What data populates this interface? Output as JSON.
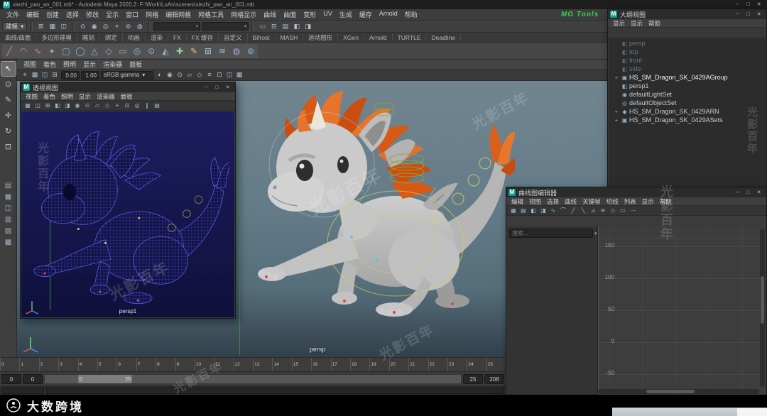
{
  "window": {
    "title": "xiezhi_pao_an_001.mb* - Autodesk Maya 2020.2: F:\\Work\\LuAn\\scenes\\xiezhi_pao_an_001.mb",
    "minimize": "─",
    "maximize": "□",
    "close": "✕"
  },
  "colors": {
    "accent_teal": "#0e9e93",
    "mane_orange": "#e0671c",
    "wire_blue": "#4646d8",
    "mg_green": "#38d053",
    "viewport_top": "#71858f",
    "wire_bg": "#14144a"
  },
  "menubar": {
    "items": [
      "文件",
      "编辑",
      "创建",
      "选择",
      "修改",
      "显示",
      "窗口",
      "网格",
      "编辑网格",
      "网格工具",
      "网格显示",
      "曲线",
      "曲面",
      "变形",
      "UV",
      "生成",
      "缓存",
      "Arnold",
      "帮助"
    ],
    "plugin": "MG Tools"
  },
  "statusline": {
    "workspace": "建模",
    "caret": "▾",
    "icons_a": [
      "⊞",
      "▦",
      "◫"
    ],
    "icons_b": [
      "⊙",
      "◉",
      "◎",
      "⌖",
      "⊚",
      "◍"
    ],
    "icons_c": [
      "▭",
      "⊟",
      "▤",
      "◧",
      "◨"
    ]
  },
  "shelf": {
    "tabs": [
      "曲线/曲面",
      "多边形建模",
      "雕刻",
      "绑定",
      "动画",
      "渲染",
      "FX",
      "FX 缓存",
      "自定义",
      "Bifrost",
      "MASH",
      "运动图形",
      "XGen",
      "Arnold",
      "TURTLE",
      "Deadline"
    ],
    "icons": [
      {
        "g": "╱",
        "c": "#d88a8a"
      },
      {
        "g": "◠",
        "c": "#d88a8a"
      },
      {
        "g": "∿",
        "c": "#d88a8a"
      },
      {
        "g": "+",
        "c": "#cfcfcf"
      },
      {
        "g": "▢",
        "c": "#8fb8d8"
      },
      {
        "g": "◯",
        "c": "#8fb8d8"
      },
      {
        "g": "△",
        "c": "#8fb8d8"
      },
      {
        "g": "◇",
        "c": "#8fb8d8"
      },
      {
        "g": "▭",
        "c": "#8fb8d8"
      },
      {
        "g": "◎",
        "c": "#8fb8d8"
      },
      {
        "g": "⊙",
        "c": "#8fb8d8"
      },
      {
        "g": "◭",
        "c": "#8fb8d8"
      },
      {
        "g": "✚",
        "c": "#9fd09f"
      },
      {
        "g": "✎",
        "c": "#d8c878"
      },
      {
        "g": "⊞",
        "c": "#9fb8c8"
      },
      {
        "g": "≋",
        "c": "#9fb8c8"
      },
      {
        "g": "◍",
        "c": "#b89fd0"
      },
      {
        "g": "⊚",
        "c": "#8fb8d8"
      }
    ]
  },
  "left_toolbar": {
    "tools": [
      {
        "g": "↖",
        "cls": "active"
      },
      {
        "g": "⊙"
      },
      {
        "g": "✎"
      },
      {
        "g": "✛"
      },
      {
        "g": "↻"
      },
      {
        "g": "⊡"
      }
    ],
    "layouts": [
      "▤",
      "▦",
      "◫",
      "▥",
      "▧",
      "▩"
    ]
  },
  "viewport": {
    "menus": [
      "视图",
      "着色",
      "照明",
      "显示",
      "渲染器",
      "面板"
    ],
    "icons1": [
      "⌖",
      "▦",
      "◫",
      "⊞"
    ],
    "exposure": "0.00",
    "gamma": "1.00",
    "view_transform": "sRGB gamma",
    "caret": "▾",
    "icons2": [
      "◐",
      "◉",
      "⊙",
      "▱",
      "◇",
      "≡",
      "⊡",
      "◫",
      "▦"
    ],
    "label": "persp"
  },
  "persp_panel": {
    "title": "透视视图",
    "menus": [
      "视图",
      "着色",
      "照明",
      "显示",
      "渲染器",
      "面板"
    ],
    "tools": [
      "▦",
      "◫",
      "⊞",
      "◧",
      "◨",
      "◉",
      "⊙",
      "▱",
      "◇",
      "≡",
      "⊡",
      "◎",
      "∥",
      "▤"
    ],
    "label": "persp1"
  },
  "outliner": {
    "title": "大纲视图",
    "menus": [
      "显示",
      "显示",
      "帮助"
    ],
    "items": [
      {
        "exp": "",
        "g": "◧",
        "label": "persp",
        "cls": "dim"
      },
      {
        "exp": "",
        "g": "◧",
        "label": "top",
        "cls": "dim"
      },
      {
        "exp": "",
        "g": "◧",
        "label": "front",
        "cls": "dim"
      },
      {
        "exp": "",
        "g": "◧",
        "label": "side",
        "cls": "dim"
      },
      {
        "exp": "+",
        "g": "▣",
        "label": "HS_SM_Dragon_SK_0429AGroup",
        "cls": "sel"
      },
      {
        "exp": "",
        "g": "◧",
        "label": "persp1",
        "cls": ""
      },
      {
        "exp": "",
        "g": "◉",
        "label": "defaultLightSet",
        "cls": ""
      },
      {
        "exp": "",
        "g": "◎",
        "label": "defaultObjectSet",
        "cls": ""
      },
      {
        "exp": "+",
        "g": "◆",
        "label": "HS_SM_Dragon_SK_0429ARN",
        "cls": ""
      },
      {
        "exp": "+",
        "g": "▣",
        "label": "HS_SM_Dragon_SK_0429ASets",
        "cls": ""
      }
    ]
  },
  "graph_editor": {
    "title": "曲线图编辑器",
    "menus": [
      "编辑",
      "视图",
      "选择",
      "曲线",
      "关键帧",
      "切线",
      "列表",
      "显示",
      "帮助"
    ],
    "toolbar": [
      "▦",
      "▤",
      "◧",
      "◨",
      "∿",
      "⌒",
      "╱",
      "╲",
      "⊿",
      "≋",
      "◇",
      "▭",
      "⋯"
    ],
    "search_placeholder": "搜索...",
    "caret": "▾",
    "y_labels": [
      "150",
      "100",
      "50",
      "0",
      "-50"
    ]
  },
  "timeline": {
    "ticks": [
      "0",
      "1",
      "2",
      "3",
      "4",
      "5",
      "6",
      "7",
      "8",
      "9",
      "10",
      "11",
      "12",
      "13",
      "14",
      "15",
      "16",
      "17",
      "18",
      "19",
      "20",
      "21",
      "22",
      "23",
      "24",
      "25"
    ]
  },
  "range": {
    "anim_start": "0",
    "play_start": "0",
    "play_end": "25",
    "anim_end": "208",
    "handle_start": "0",
    "handle_end": "25"
  },
  "footer": {
    "brand": "大数跨境"
  },
  "watermark": {
    "text": "光影百年"
  }
}
